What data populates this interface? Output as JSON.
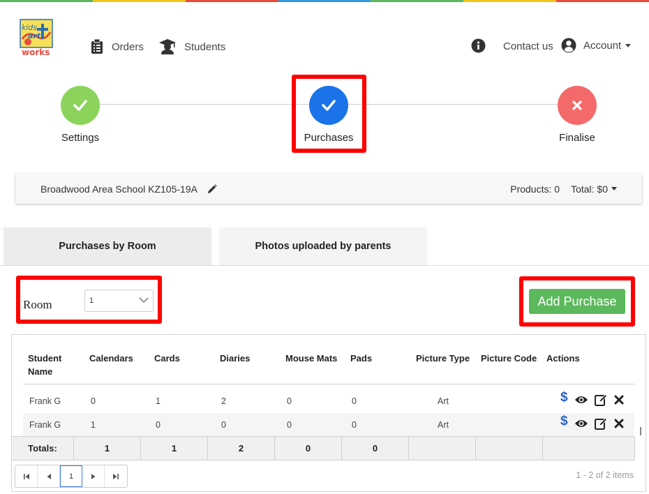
{
  "colors": {
    "top_stripe": [
      "#5cb85c",
      "#f0c419",
      "#e74c3c",
      "#3498db",
      "#5cb85c",
      "#f0c419",
      "#e74c3c"
    ],
    "step_done": "#8cd35c",
    "step_active": "#1a73e8",
    "step_pending": "#f46a6a",
    "add_button": "#5cb85c",
    "highlight": "#ff0000"
  },
  "header": {
    "logo": {
      "line1": "kids",
      "line2": "art",
      "line3": "works"
    },
    "nav": [
      {
        "label": "Orders",
        "icon": "clipboard-icon"
      },
      {
        "label": "Students",
        "icon": "graduate-icon"
      }
    ],
    "info_icon": "info-circle-icon",
    "contact_label": "Contact us",
    "account_label": "Account"
  },
  "stepper": {
    "steps": [
      {
        "label": "Settings",
        "state": "done",
        "icon": "check-icon"
      },
      {
        "label": "Purchases",
        "state": "active",
        "icon": "check-icon"
      },
      {
        "label": "Finalise",
        "state": "pending",
        "icon": "close-icon"
      }
    ]
  },
  "order": {
    "school": "Broadwood Area School KZ105-19A",
    "products": "Products: 0",
    "total": "Total: $0"
  },
  "tabs": [
    {
      "label": "Purchases by Room"
    },
    {
      "label": "Photos uploaded by parents"
    }
  ],
  "room": {
    "label": "Room",
    "selected": "1"
  },
  "add_purchase_label": "Add Purchase",
  "grid": {
    "headers": [
      "Student Name",
      "Calendars",
      "Cards",
      "Diaries",
      "Mouse Mats",
      "Pads",
      "Picture Type",
      "Picture Code",
      "Actions"
    ],
    "rows": [
      {
        "name": "Frank G",
        "calendars": "0",
        "cards": "1",
        "diaries": "2",
        "mouse_mats": "0",
        "pads": "0",
        "picture_type": "Art",
        "picture_code": ""
      },
      {
        "name": "Frank G",
        "calendars": "1",
        "cards": "0",
        "diaries": "0",
        "mouse_mats": "0",
        "pads": "0",
        "picture_type": "Art",
        "picture_code": ""
      }
    ],
    "totals": {
      "label": "Totals:",
      "calendars": "1",
      "cards": "1",
      "diaries": "2",
      "mouse_mats": "0",
      "pads": "0"
    },
    "action_icons": [
      "dollar-icon",
      "eye-icon",
      "edit-icon",
      "delete-icon"
    ],
    "pager": {
      "current_page": "1",
      "items_info": "1 - 2 of 2 items"
    }
  }
}
